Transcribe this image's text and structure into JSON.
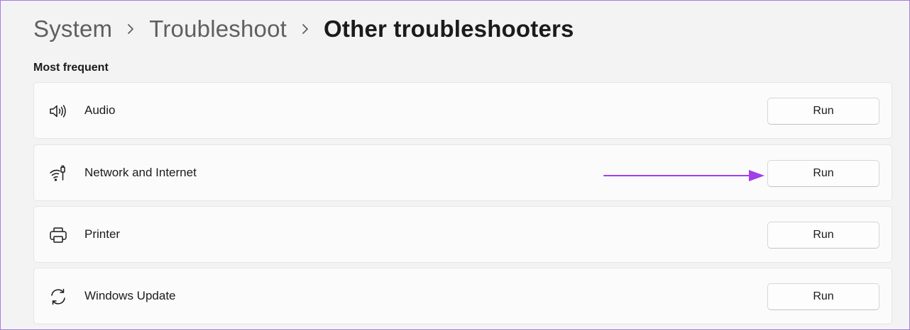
{
  "breadcrumb": {
    "items": [
      "System",
      "Troubleshoot",
      "Other troubleshooters"
    ]
  },
  "section": {
    "title": "Most frequent"
  },
  "troubleshooters": [
    {
      "label": "Audio",
      "icon": "speaker-icon",
      "button": "Run"
    },
    {
      "label": "Network and Internet",
      "icon": "network-icon",
      "button": "Run"
    },
    {
      "label": "Printer",
      "icon": "printer-icon",
      "button": "Run"
    },
    {
      "label": "Windows Update",
      "icon": "sync-icon",
      "button": "Run"
    }
  ],
  "colors": {
    "annotation_arrow": "#a23fe8",
    "frame_border": "#a57be0"
  }
}
